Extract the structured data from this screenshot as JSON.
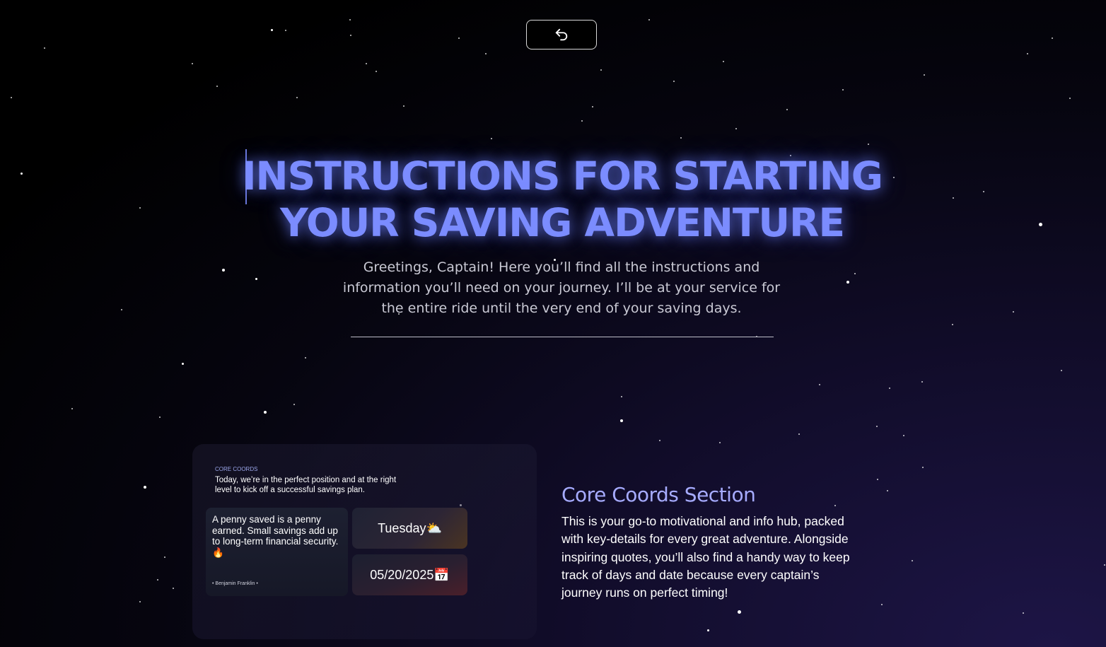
{
  "nav": {
    "back_icon": "back-arrow-icon"
  },
  "hero": {
    "title": "INSTRUCTIONS FOR STARTING YOUR SAVING ADVENTURE",
    "subtitle": "Greetings, Captain! Here you’ll find all the instructions and information you’ll need on your journey. I’ll be at your service for the entire ride until the very end of your saving days."
  },
  "core_coords": {
    "label": "CORE COORDS",
    "intro": "Today, we’re in the perfect position and at the right level to kick off a successful savings plan.",
    "quote": "A penny saved is a penny earned. Small savings add up to long-term financial security. 🔥",
    "author": "• Benjamin Franklin •",
    "day": "Tuesday⛅",
    "date": "05/20/2025📅"
  },
  "section": {
    "title": "Core Coords Section",
    "text": "This is your go-to motivational and info hub, packed with key-details for every great adventure. Alongside inspiring quotes, you’ll also find a handy way to keep track of days and date because every captain’s journey runs on perfect timing!"
  },
  "colors": {
    "accent": "#7b8cff",
    "section_title": "#a6abff",
    "background": "#000000"
  }
}
